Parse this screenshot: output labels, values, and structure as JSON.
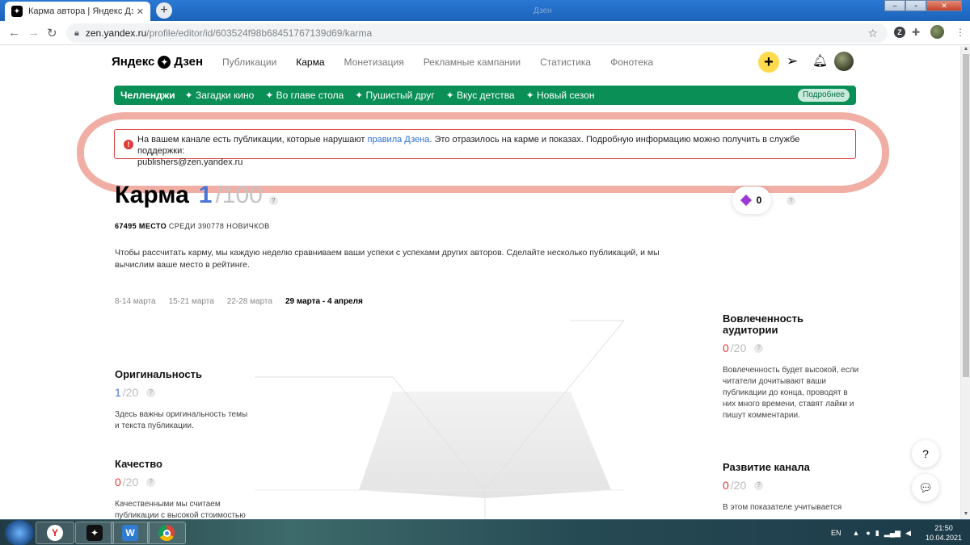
{
  "browser": {
    "tab_title": "Карма автора | Яндекс Дзен",
    "tab_close": "✕",
    "new_tab": "+",
    "faint_title": "Дзен",
    "url_host": "zen.yandex.ru",
    "url_path": "/profile/editor/id/603524f98b68451767139d69/karma",
    "win_min": "–",
    "win_max": "▫",
    "win_close": "✕"
  },
  "header": {
    "logo_left": "Яндекс",
    "logo_right": "Дзен",
    "nav": [
      "Публикации",
      "Карма",
      "Монетизация",
      "Рекламные кампании",
      "Статистика",
      "Фонотека"
    ],
    "active_index": 1
  },
  "challenges": {
    "title": "Челленджи",
    "items": [
      "✦ Загадки кино",
      "✦ Во главе стола",
      "✦ Пушистый друг",
      "✦ Вкус детства",
      "✦ Новый сезон"
    ],
    "more": "Подробнее"
  },
  "warning": {
    "text_before": "На вашем канале есть публикации, которые нарушают ",
    "link": "правила Дзена",
    "text_after": ". Это отразилось на карме и показах. Подробную информацию можно получить в службе поддержки:",
    "email": "publishers@zen.yandex.ru"
  },
  "karma": {
    "title": "Карма",
    "value": "1",
    "max": "/100",
    "place_num": "67495 МЕСТО",
    "place_rest": " СРЕДИ 390778 НОВИЧКОВ",
    "gems": "0",
    "description": "Чтобы рассчитать карму, мы каждую неделю сравниваем ваши успехи с успехами других авторов. Сделайте несколько публикаций, и мы вычислим ваше место в рейтинге."
  },
  "weeks": [
    "8-14 марта",
    "15-21 марта",
    "22-28 марта",
    "29 марта - 4 апреля"
  ],
  "active_week": 3,
  "metrics": {
    "originality": {
      "title": "Оригинальность",
      "value": "1",
      "max": "/20",
      "desc": "Здесь важны оригинальность темы и текста публикации."
    },
    "quality": {
      "title": "Качество",
      "value": "0",
      "max": "/20",
      "desc": "Качественными мы считаем публикации с высокой стоимостью"
    },
    "engagement": {
      "title": "Вовлеченность аудитории",
      "value": "0",
      "max": "/20",
      "desc": "Вовлеченность будет высокой, если читатели дочитывают ваши публикации до конца, проводят в них много времени, ставят лайки и пишут комментарии."
    },
    "growth": {
      "title": "Развитие канала",
      "value": "0",
      "max": "/20",
      "desc": "В этом показателе учитывается"
    }
  },
  "side": {
    "help": "?"
  },
  "taskbar": {
    "lang": "EN",
    "time": "21:50",
    "date": "10.04.2021"
  }
}
